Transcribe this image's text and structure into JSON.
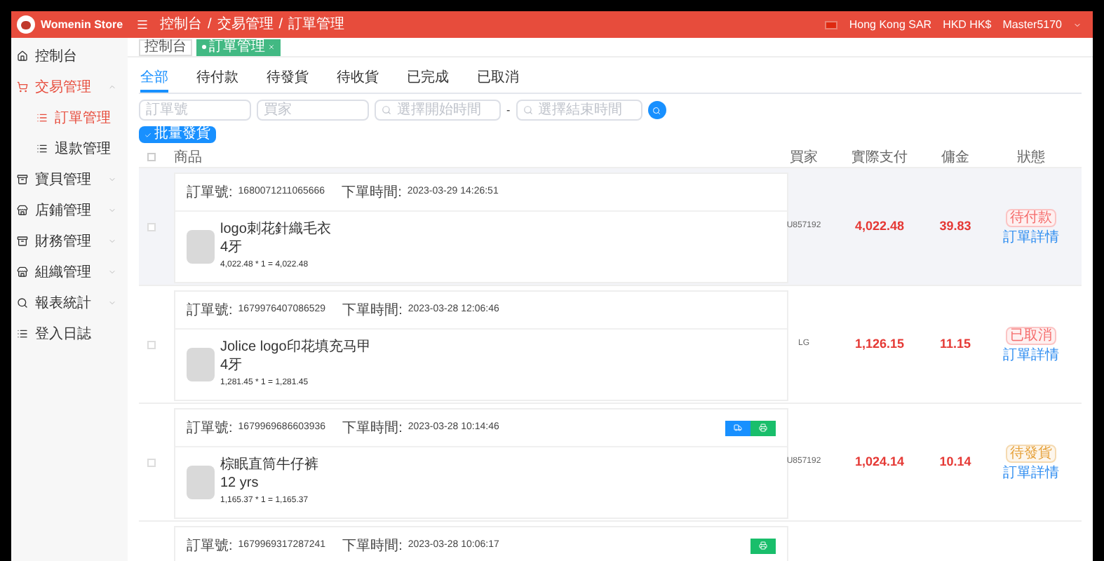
{
  "brand": {
    "name": "Womenin Store"
  },
  "breadcrumb": [
    "控制台",
    "交易管理",
    "訂單管理"
  ],
  "breadcrumb_separator": "/",
  "header_right": {
    "region": "Hong Kong SAR",
    "currency": "HKD HK$",
    "user": "Master5170"
  },
  "sidebar": {
    "items": [
      {
        "label": "控制台",
        "selected": false
      },
      {
        "label": "交易管理",
        "selected": true,
        "expanded": true,
        "children": [
          {
            "label": "訂單管理",
            "selected": true
          },
          {
            "label": "退款管理",
            "selected": false
          }
        ]
      },
      {
        "label": "寶貝管理",
        "selected": false,
        "expanded": false
      },
      {
        "label": "店鋪管理",
        "selected": false,
        "expanded": false
      },
      {
        "label": "財務管理",
        "selected": false,
        "expanded": false
      },
      {
        "label": "組織管理",
        "selected": false,
        "expanded": false
      },
      {
        "label": "報表統計",
        "selected": false,
        "expanded": false
      },
      {
        "label": "登入日誌",
        "selected": false
      }
    ]
  },
  "page_tabs": [
    {
      "label": "控制台",
      "selected": false
    },
    {
      "label": "訂單管理",
      "selected": true
    }
  ],
  "status_tabs": [
    {
      "label": "全部",
      "selected": true
    },
    {
      "label": "待付款",
      "selected": false
    },
    {
      "label": "待發貨",
      "selected": false
    },
    {
      "label": "待收貨",
      "selected": false
    },
    {
      "label": "已完成",
      "selected": false
    },
    {
      "label": "已取消",
      "selected": false
    }
  ],
  "filters": {
    "order_placeholder": "訂單號",
    "buyer_placeholder": "買家",
    "start_placeholder": "選擇開始時間",
    "separator": "-",
    "end_placeholder": "選擇結束時間"
  },
  "batch_button": "批量發貨",
  "table": {
    "header_checked": false,
    "columns": [
      "商品",
      "買家",
      "實際支付",
      "傭金",
      "狀態"
    ],
    "rows": [
      {
        "selected": true,
        "checked": false,
        "order_label": "訂單號:",
        "order_no": "1680071211065666",
        "time_label": "下單時間:",
        "time": "2023-03-29 14:26:51",
        "actions": [],
        "product": {
          "name": "logo刺花針織毛衣",
          "variant": "4牙",
          "price": "4,022.48 * 1 = 4,022.48"
        },
        "buyer": "U857192",
        "paid": "4,022.48",
        "commission": "39.83",
        "status": {
          "label": "待付款",
          "kind": "pending"
        },
        "detail": "訂單詳情"
      },
      {
        "selected": false,
        "checked": false,
        "order_label": "訂單號:",
        "order_no": "1679976407086529",
        "time_label": "下單時間:",
        "time": "2023-03-28 12:06:46",
        "actions": [],
        "product": {
          "name": "Jolice logo印花填充马甲",
          "variant": "4牙",
          "price": "1,281.45 * 1 = 1,281.45"
        },
        "buyer": "LG",
        "paid": "1,126.15",
        "commission": "11.15",
        "status": {
          "label": "已取消",
          "kind": "cancelled"
        },
        "detail": "訂單詳情"
      },
      {
        "selected": false,
        "checked": false,
        "order_label": "訂單號:",
        "order_no": "1679969686603936",
        "time_label": "下單時間:",
        "time": "2023-03-28 10:14:46",
        "actions": [
          {
            "kind": "ship"
          },
          {
            "kind": "print"
          }
        ],
        "product": {
          "name": "棕眠直筒牛仔裤",
          "variant": "12 yrs",
          "price": "1,165.37 * 1 = 1,165.37"
        },
        "buyer": "U857192",
        "paid": "1,024.14",
        "commission": "10.14",
        "status": {
          "label": "待發貨",
          "kind": "to_ship"
        },
        "detail": "訂單詳情"
      },
      {
        "selected": false,
        "order_label": "訂單號:",
        "order_no": "1679969317287241",
        "time_label": "下單時間:",
        "time": "2023-03-28 10:06:17",
        "actions": [
          {
            "kind": "print"
          }
        ]
      }
    ]
  }
}
